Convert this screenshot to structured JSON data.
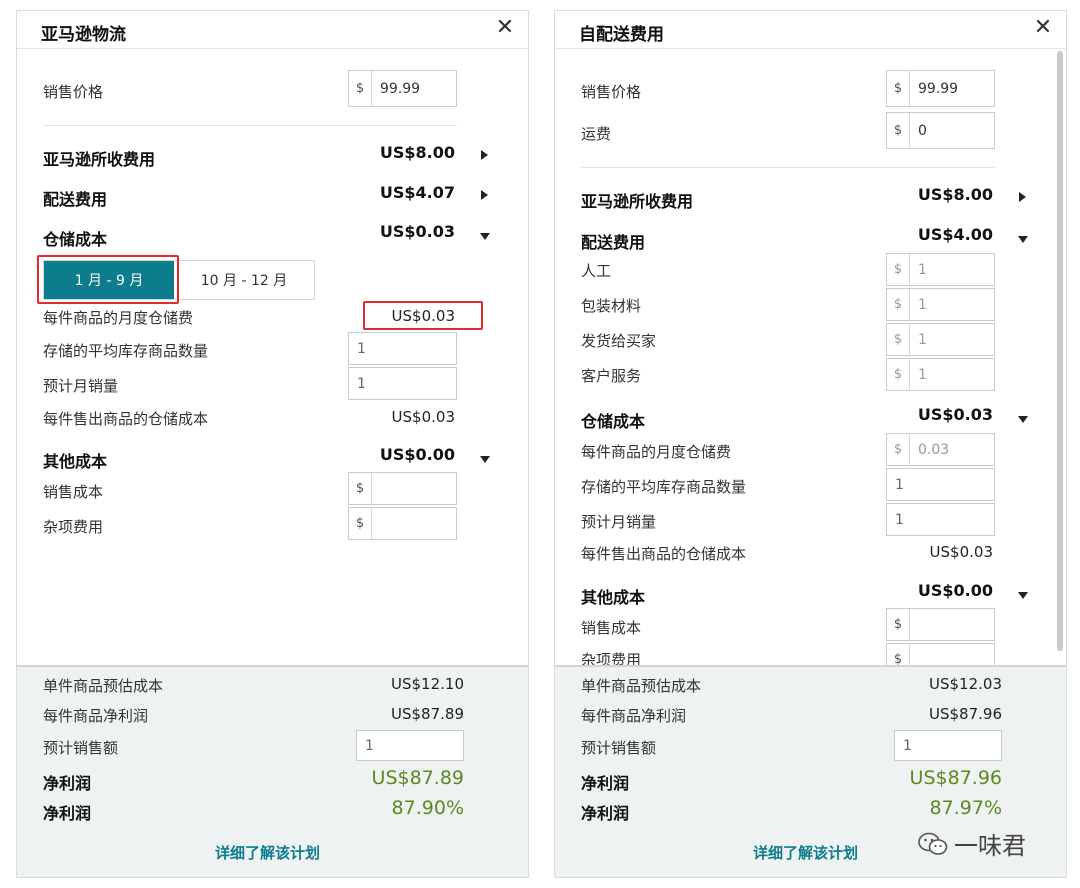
{
  "left": {
    "title": "亚马逊物流",
    "price_label": "销售价格",
    "currency": "$",
    "price_value": "99.99",
    "amazon_fees_label": "亚马逊所收费用",
    "amazon_fees_value": "US$8.00",
    "fulfillment_label": "配送费用",
    "fulfillment_value": "US$4.07",
    "storage_label": "仓储成本",
    "storage_value": "US$0.03",
    "season_tabs": [
      "1 月 - 9 月",
      "10 月 - 12 月"
    ],
    "monthly_storage_label": "每件商品的月度仓储费",
    "monthly_storage_value": "US$0.03",
    "avg_inventory_label": "存储的平均库存商品数量",
    "avg_inventory_value": "1",
    "monthly_sales_label": "预计月销量",
    "monthly_sales_value": "1",
    "storage_per_sold_label": "每件售出商品的仓储成本",
    "storage_per_sold_value": "US$0.03",
    "other_label": "其他成本",
    "other_value": "US$0.00",
    "cogs_label": "销售成本",
    "misc_label": "杂项费用",
    "footer": {
      "unit_cost_label": "单件商品预估成本",
      "unit_cost_value": "US$12.10",
      "unit_profit_label": "每件商品净利润",
      "unit_profit_value": "US$87.89",
      "est_sales_label": "预计销售额",
      "est_sales_value": "1",
      "net_profit_label": "净利润",
      "net_profit_value": "US$87.89",
      "net_margin_label": "净利润",
      "net_margin_value": "87.90%",
      "learn_more": "详细了解该计划"
    }
  },
  "right": {
    "title": "自配送费用",
    "price_label": "销售价格",
    "currency": "$",
    "price_value": "99.99",
    "shipping_label": "运费",
    "shipping_value": "0",
    "amazon_fees_label": "亚马逊所收费用",
    "amazon_fees_value": "US$8.00",
    "fulfillment_label": "配送费用",
    "fulfillment_value": "US$4.00",
    "labor_label": "人工",
    "labor_value": "1",
    "packaging_label": "包装材料",
    "packaging_value": "1",
    "ship_buyer_label": "发货给买家",
    "ship_buyer_value": "1",
    "customer_service_label": "客户服务",
    "customer_service_value": "1",
    "storage_label": "仓储成本",
    "storage_value": "US$0.03",
    "monthly_storage_label": "每件商品的月度仓储费",
    "monthly_storage_value": "0.03",
    "avg_inventory_label": "存储的平均库存商品数量",
    "avg_inventory_value": "1",
    "monthly_sales_label": "预计月销量",
    "monthly_sales_value": "1",
    "storage_per_sold_label": "每件售出商品的仓储成本",
    "storage_per_sold_value": "US$0.03",
    "other_label": "其他成本",
    "other_value": "US$0.00",
    "cogs_label": "销售成本",
    "misc_label": "杂项费用",
    "footer": {
      "unit_cost_label": "单件商品预估成本",
      "unit_cost_value": "US$12.03",
      "unit_profit_label": "每件商品净利润",
      "unit_profit_value": "US$87.96",
      "est_sales_label": "预计销售额",
      "est_sales_value": "1",
      "net_profit_label": "净利润",
      "net_profit_value": "US$87.96",
      "net_margin_label": "净利润",
      "net_margin_value": "87.97%",
      "learn_more": "详细了解该计划"
    }
  },
  "close_symbol": "✕",
  "watermark": "一味君",
  "colors": {
    "accent": "#0d7c8c",
    "profit_green": "#5a8a1e",
    "highlight_red": "#e32b2b"
  }
}
